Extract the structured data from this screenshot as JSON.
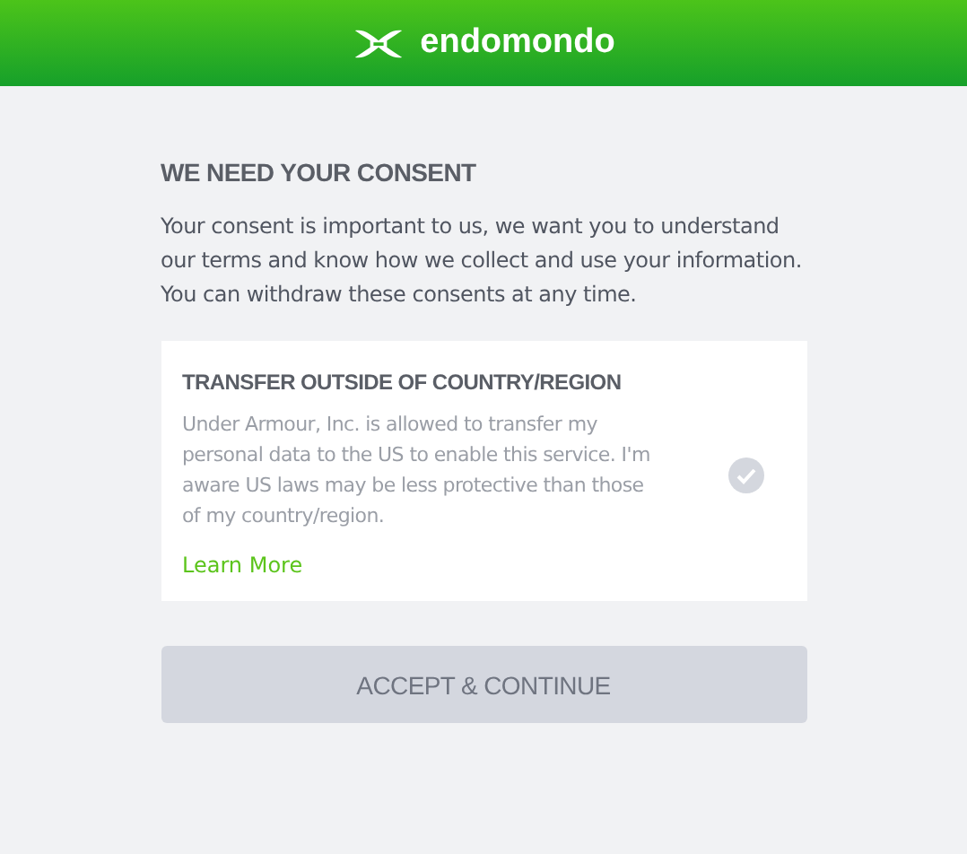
{
  "header": {
    "brand": "endomondo"
  },
  "consent": {
    "heading": "WE NEED YOUR CONSENT",
    "intro": "Your consent is important to us, we want you to understand our terms and know how we collect and use your information. You can withdraw these consents at any time.",
    "items": [
      {
        "title": "TRANSFER OUTSIDE OF COUNTRY/REGION",
        "text": "Under Armour, Inc. is allowed to transfer my personal data to the US to enable this service. I'm aware US laws may be less protective than those of my country/region.",
        "link": "Learn More",
        "checked": false
      }
    ]
  },
  "button": {
    "label": "ACCEPT & CONTINUE",
    "disabled": true
  }
}
